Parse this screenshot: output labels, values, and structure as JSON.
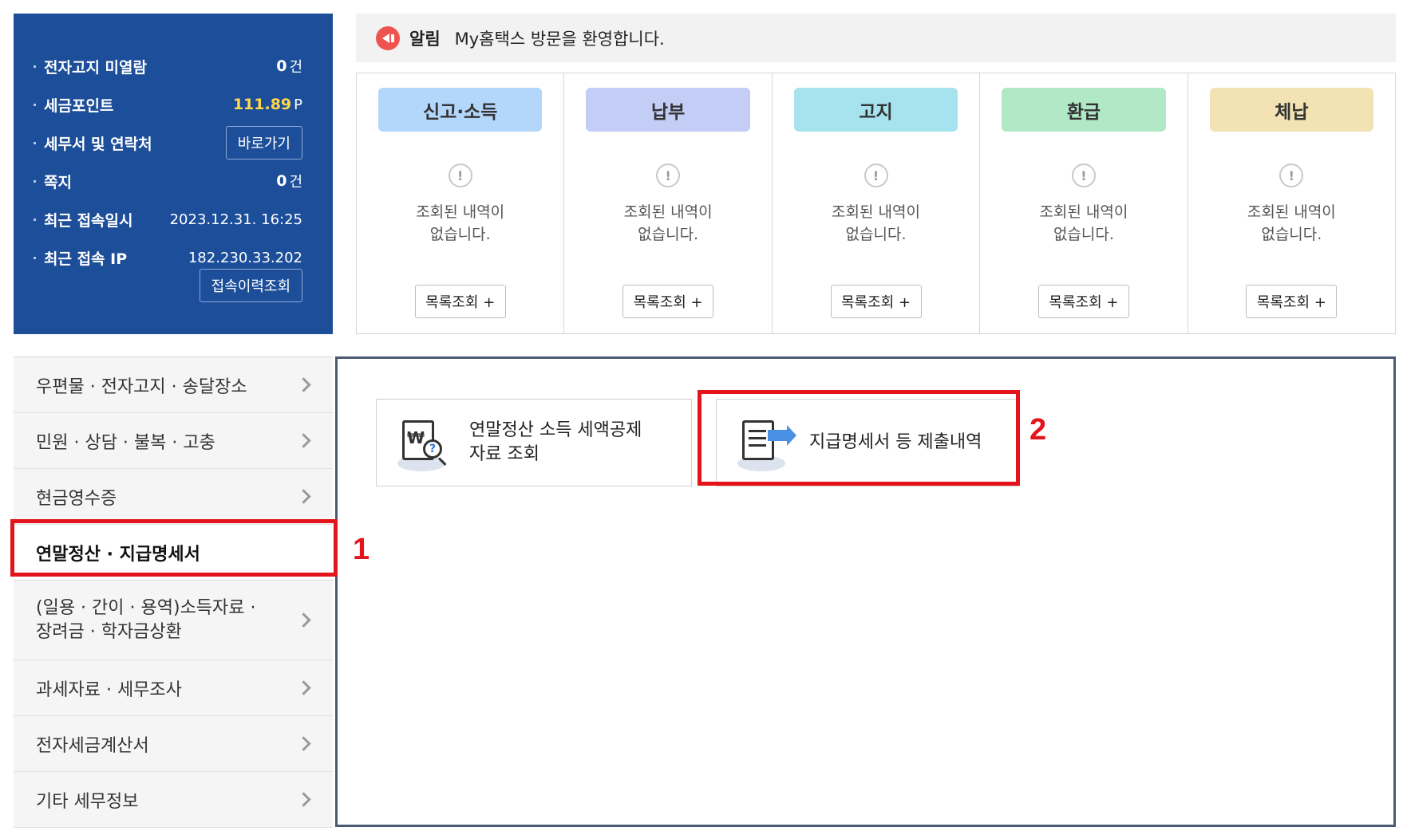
{
  "info_panel": {
    "unread_notice": {
      "label": "전자고지 미열람",
      "value": "0",
      "unit": "건"
    },
    "tax_points": {
      "label": "세금포인트",
      "value": "111.89",
      "unit": "P"
    },
    "tax_office": {
      "label": "세무서 및 연락처",
      "button": "바로가기"
    },
    "notes": {
      "label": "쪽지",
      "value": "0",
      "unit": "건"
    },
    "last_login_time": {
      "label": "최근 접속일시",
      "value": "2023.12.31.  16:25"
    },
    "last_login_ip": {
      "label": "최근 접속 IP",
      "value": "182.230.33.202"
    },
    "history_button": "접속이력조회"
  },
  "notice": {
    "title": "알림",
    "text": "My홈택스 방문을 환영합니다."
  },
  "status_cards": [
    {
      "title": "신고·소득",
      "color": "#b3d6fb",
      "message_1": "조회된 내역이",
      "message_2": "없습니다.",
      "button": "목록조회 +"
    },
    {
      "title": "납부",
      "color": "#c3cdf6",
      "message_1": "조회된 내역이",
      "message_2": "없습니다.",
      "button": "목록조회 +"
    },
    {
      "title": "고지",
      "color": "#a6e3ef",
      "message_1": "조회된 내역이",
      "message_2": "없습니다.",
      "button": "목록조회 +"
    },
    {
      "title": "환급",
      "color": "#b1e8c6",
      "message_1": "조회된 내역이",
      "message_2": "없습니다.",
      "button": "목록조회 +"
    },
    {
      "title": "체납",
      "color": "#f3e3b4",
      "message_1": "조회된 내역이",
      "message_2": "없습니다.",
      "button": "목록조회 +"
    }
  ],
  "side_menu": [
    {
      "label": "우편물 · 전자고지 · 송달장소"
    },
    {
      "label": "민원 · 상담 · 불복 · 고충"
    },
    {
      "label": "현금영수증"
    },
    {
      "label": "연말정산 · 지급명세서",
      "active": true
    },
    {
      "label_1": "(일용 · 간이 · 용역)소득자료 ·",
      "label_2": "장려금 · 학자금상환"
    },
    {
      "label": "과세자료 · 세무조사"
    },
    {
      "label": "전자세금계산서"
    },
    {
      "label": "기타 세무정보"
    }
  ],
  "content_cards": [
    {
      "label_1": "연말정산 소득 세액공제",
      "label_2": "자료 조회",
      "icon": "document-search-icon"
    },
    {
      "label": "지급명세서 등 제출내역",
      "icon": "document-submit-icon"
    }
  ],
  "annotations": {
    "one": "1",
    "two": "2",
    "color": "#e3141b"
  }
}
